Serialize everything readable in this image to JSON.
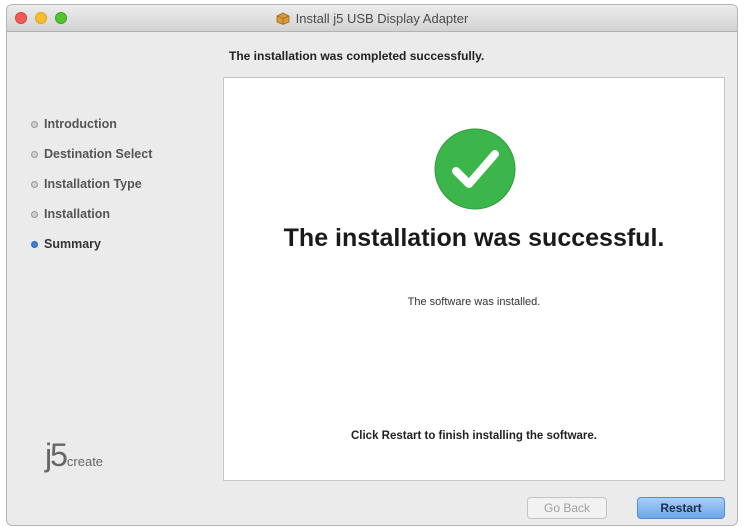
{
  "window": {
    "title": "Install j5 USB Display Adapter",
    "controls": [
      "close",
      "minimize",
      "zoom"
    ]
  },
  "header": {
    "text": "The installation was completed successfully."
  },
  "sidebar": {
    "steps": [
      {
        "label": "Introduction",
        "active": false
      },
      {
        "label": "Destination Select",
        "active": false
      },
      {
        "label": "Installation Type",
        "active": false
      },
      {
        "label": "Installation",
        "active": false
      },
      {
        "label": "Summary",
        "active": true
      }
    ],
    "logo": {
      "main": "j5",
      "sub": "create"
    }
  },
  "main": {
    "icon": "checkmark-icon",
    "success_title": "The installation was successful.",
    "installed_text": "The software was installed.",
    "restart_note": "Click Restart to finish installing the software."
  },
  "buttons": {
    "back_label": "Go Back",
    "restart_label": "Restart"
  },
  "colors": {
    "check_green": "#3cb54a",
    "active_step": "#3a7fd8",
    "default_button": "#6aa6ea"
  }
}
